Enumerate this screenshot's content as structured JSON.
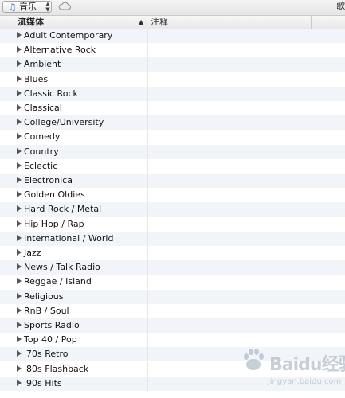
{
  "toolbar": {
    "source": "音乐",
    "corner_glyph": "歌"
  },
  "columns": {
    "stream": "流媒体",
    "comment": "注释"
  },
  "genres": [
    "Adult Contemporary",
    "Alternative Rock",
    "Ambient",
    "Blues",
    "Classic Rock",
    "Classical",
    "College/University",
    "Comedy",
    "Country",
    "Eclectic",
    "Electronica",
    "Golden Oldies",
    "Hard Rock / Metal",
    "Hip Hop / Rap",
    "International / World",
    "Jazz",
    "News / Talk Radio",
    "Reggae / Island",
    "Religious",
    "RnB / Soul",
    "Sports Radio",
    "Top 40 / Pop",
    "'70s Retro",
    "'80s Flashback",
    "'90s Hits"
  ],
  "watermark": {
    "logo": "Baidu经验",
    "url": "jingyan.baidu.com"
  },
  "colors": {
    "row_alt": "#f1f5fa",
    "accent": "#3b7bd8"
  }
}
